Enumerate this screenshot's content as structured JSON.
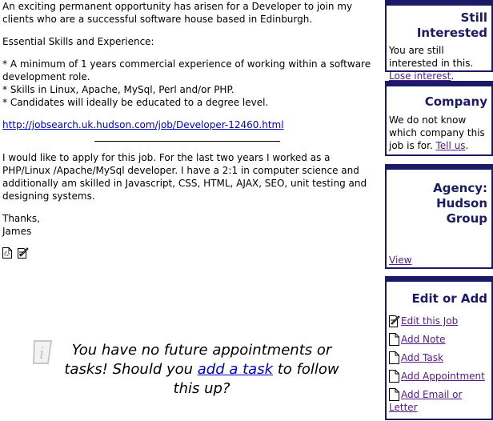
{
  "job_description": {
    "intro": "An exciting permanent opportunity has arisen for a Developer to join my clients who are a successful software house based in Edinburgh.",
    "skills_heading": "Essential Skills and Experience:",
    "bullets": [
      "* A minimum of 1 years commercial experience of working within a software development role.",
      "* Skills in Linux, Apache, MySql, Perl and/or PHP.",
      "* Candidates will ideally be educated to a degree level."
    ],
    "job_link": "http://jobsearch.uk.hudson.com/job/Developer-12460.html"
  },
  "application_note": {
    "body": "I would like to apply for this job. For the last two years I worked as a PHP/Linux /Apache/MySql developer. I have a 2:1 in computer science and additionally am skilled in Javascript, CSS, HTML, AJAX, SEO, unit testing and designing systems.",
    "signoff": "Thanks,",
    "name": "James"
  },
  "doc_icons": [
    "view-document-icon",
    "edit-document-icon"
  ],
  "notice": {
    "icon": "info-icon",
    "text_before": "You have no future appointments or tasks! Should you ",
    "link_text": "add a task",
    "text_after": " to follow this up?"
  },
  "sidebar": {
    "still_interested": {
      "title": "Still Interested",
      "text": "You are still interested in this. ",
      "link": "Lose interest",
      "suffix": "."
    },
    "company": {
      "title": "Company",
      "text": "We do not know which company this job is for. ",
      "link": "Tell us",
      "suffix": "."
    },
    "agency": {
      "title": "Agency: Hudson Group",
      "link": "View"
    },
    "edit_or_add": {
      "title": "Edit or Add",
      "actions": [
        {
          "label": "Edit this Job",
          "icon": "edit-document-icon"
        },
        {
          "label": "Add Note",
          "icon": "document-icon"
        },
        {
          "label": "Add Task",
          "icon": "document-icon"
        },
        {
          "label": "Add Appointment",
          "icon": "document-icon"
        },
        {
          "label": "Add Email or Letter",
          "icon": "document-icon"
        }
      ]
    }
  }
}
